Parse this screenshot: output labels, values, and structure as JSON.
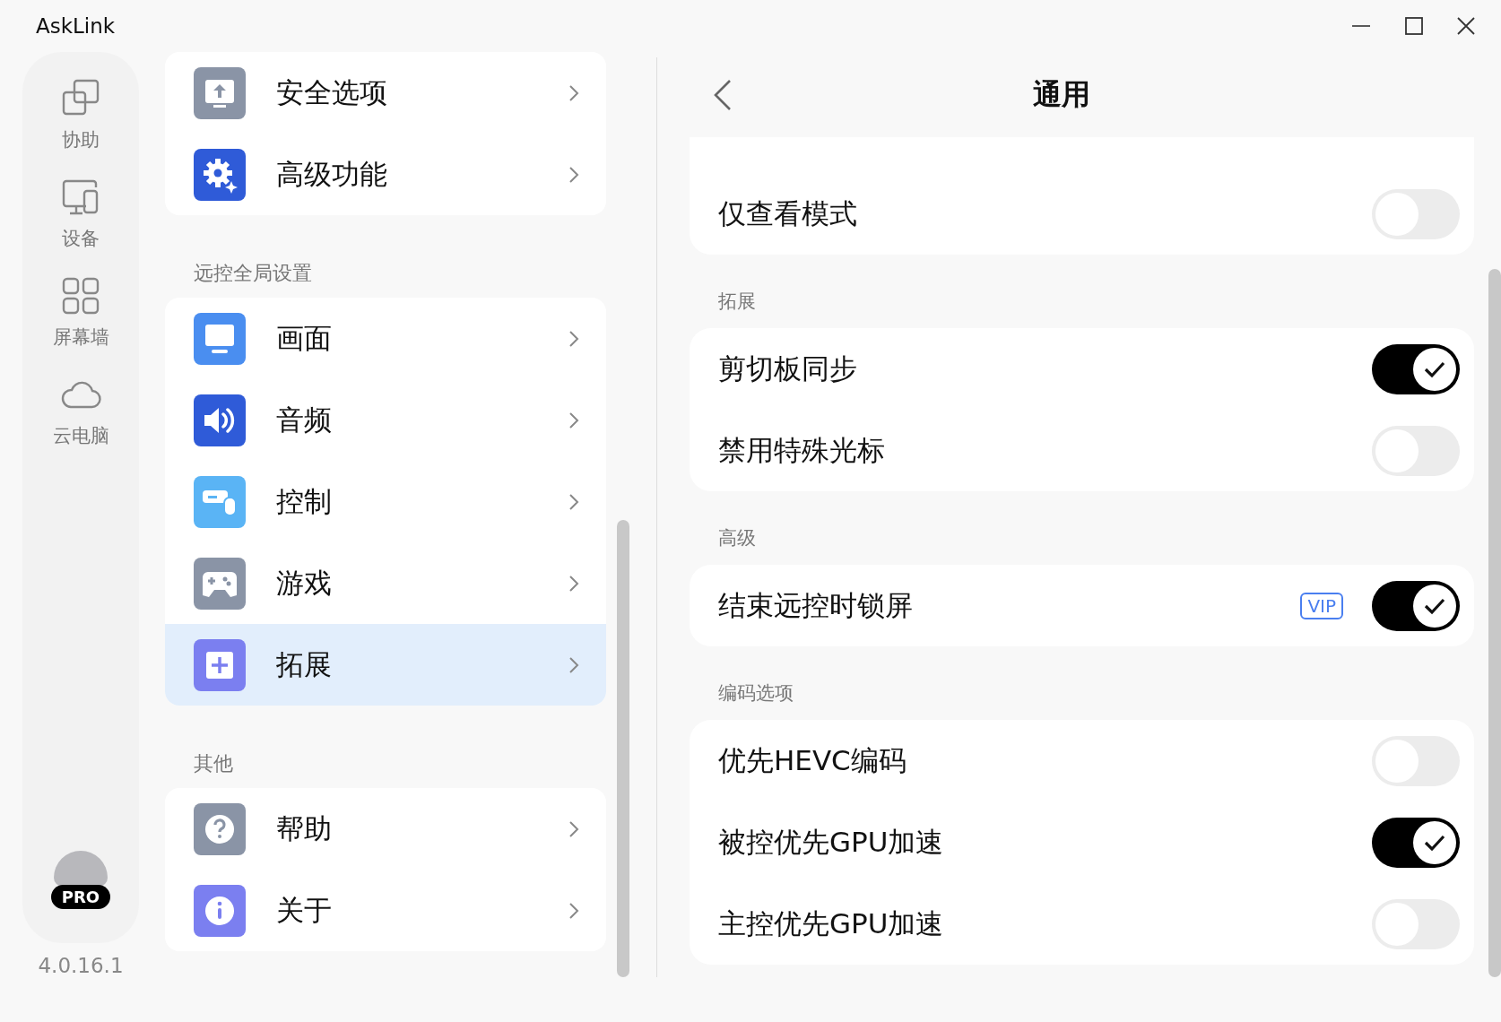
{
  "window": {
    "title": "AskLink"
  },
  "nav": [
    {
      "label": "协助",
      "kind": "copy"
    },
    {
      "label": "设备",
      "kind": "devices"
    },
    {
      "label": "屏幕墙",
      "kind": "grid"
    },
    {
      "label": "云电脑",
      "kind": "cloud"
    }
  ],
  "account": {
    "badge": "PRO"
  },
  "version": "4.0.16.1",
  "menu": [
    {
      "items": [
        {
          "label": "安全选项",
          "kind": "upload",
          "color": "#8a94a6",
          "selected": false
        },
        {
          "label": "高级功能",
          "kind": "gear",
          "color": "#2f5bd8",
          "selected": false
        }
      ]
    },
    {
      "title": "远控全局设置",
      "items": [
        {
          "label": "画面",
          "kind": "monitor",
          "color": "#4a8ef0",
          "selected": false
        },
        {
          "label": "音频",
          "kind": "speaker",
          "color": "#2f5bd8",
          "selected": false
        },
        {
          "label": "控制",
          "kind": "control",
          "color": "#5ab4f5",
          "selected": false
        },
        {
          "label": "游戏",
          "kind": "gamepad",
          "color": "#8a94a6",
          "selected": false
        },
        {
          "label": "拓展",
          "kind": "plus",
          "color": "#7b7ff0",
          "selected": true
        }
      ]
    },
    {
      "title": "其他",
      "items": [
        {
          "label": "帮助",
          "kind": "help",
          "color": "#8a94a6",
          "selected": false
        },
        {
          "label": "关于",
          "kind": "info",
          "color": "#7b7ff0",
          "selected": false
        }
      ]
    }
  ],
  "panel": {
    "title": "通用",
    "groups": [
      {
        "rows": [
          {
            "label": "仅查看模式",
            "on": false
          }
        ]
      },
      {
        "title": "拓展",
        "rows": [
          {
            "label": "剪切板同步",
            "on": true
          },
          {
            "label": "禁用特殊光标",
            "on": false
          }
        ]
      },
      {
        "title": "高级",
        "rows": [
          {
            "label": "结束远控时锁屏",
            "badge": "VIP",
            "on": true
          }
        ]
      },
      {
        "title": "编码选项",
        "rows": [
          {
            "label": "优先HEVC编码",
            "on": false
          },
          {
            "label": "被控优先GPU加速",
            "on": true
          },
          {
            "label": "主控优先GPU加速",
            "on": false
          }
        ]
      }
    ]
  }
}
